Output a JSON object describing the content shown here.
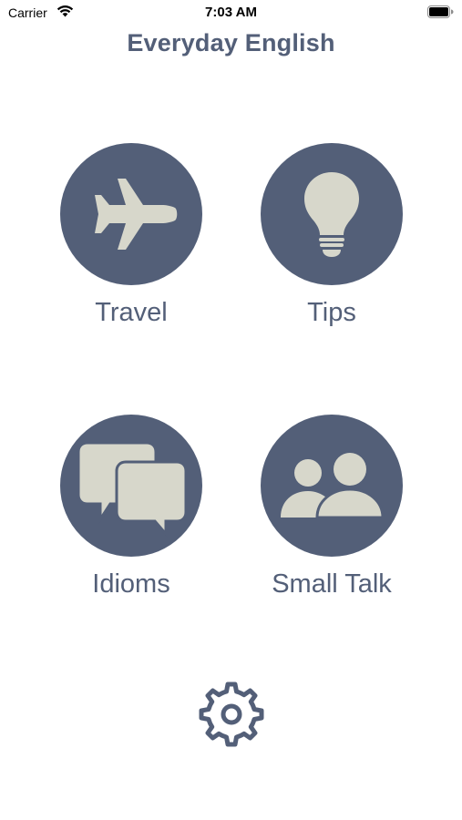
{
  "status_bar": {
    "carrier": "Carrier",
    "time": "7:03 AM"
  },
  "app_title": "Everyday English",
  "categories": [
    {
      "label": "Travel",
      "icon": "airplane-icon"
    },
    {
      "label": "Tips",
      "icon": "lightbulb-icon"
    },
    {
      "label": "Idioms",
      "icon": "speech-bubbles-icon"
    },
    {
      "label": "Small Talk",
      "icon": "people-icon"
    }
  ],
  "settings_icon": "gear-icon",
  "colors": {
    "primary": "#535f78",
    "icon_fill": "#d7d7cb",
    "background": "#ffffff"
  }
}
